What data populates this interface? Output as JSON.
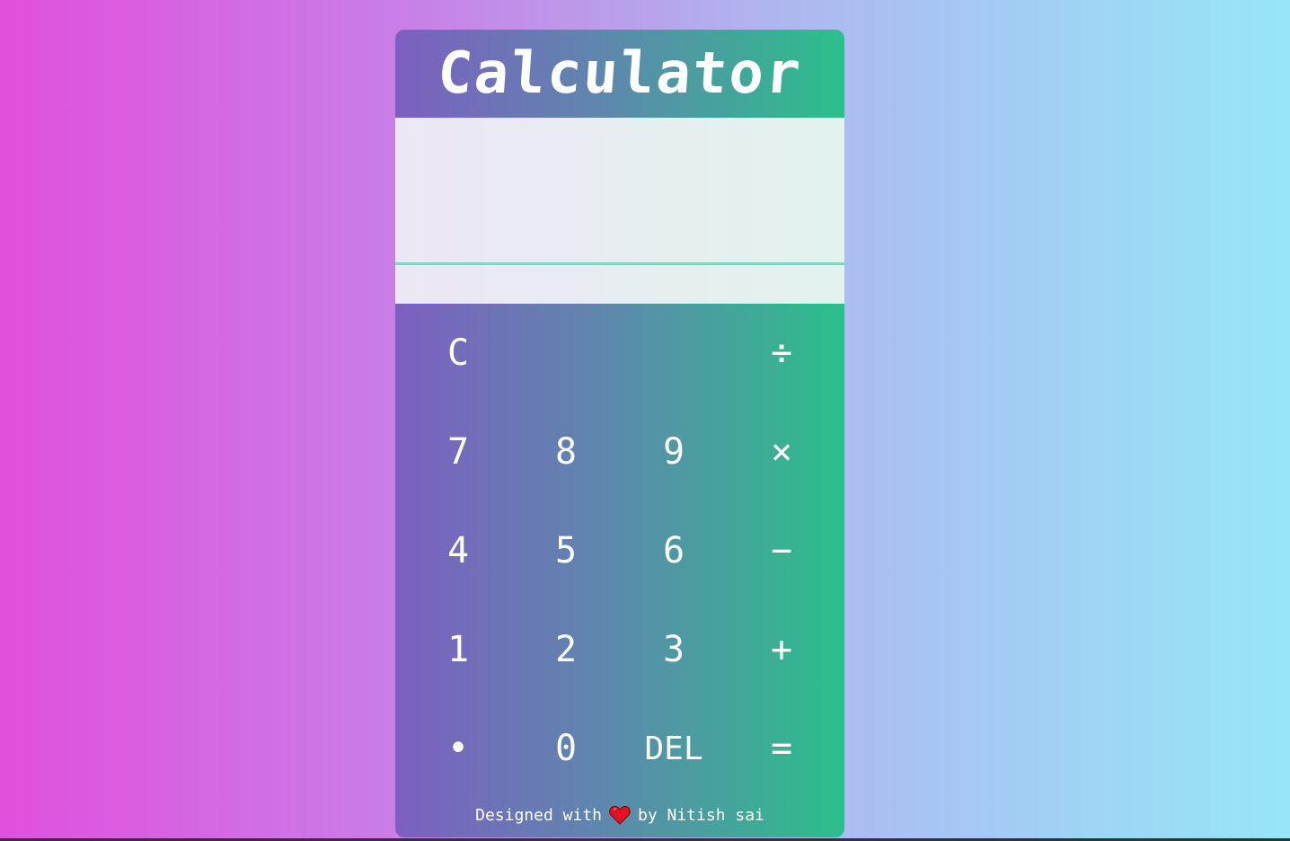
{
  "title": "Calculator",
  "display": {
    "previous": "",
    "current": ""
  },
  "keys": [
    {
      "label": "C",
      "name": "clear-button"
    },
    {
      "label": "",
      "name": "blank-key"
    },
    {
      "label": "",
      "name": "blank-key"
    },
    {
      "label": "÷",
      "name": "divide-button"
    },
    {
      "label": "7",
      "name": "digit-7-button"
    },
    {
      "label": "8",
      "name": "digit-8-button"
    },
    {
      "label": "9",
      "name": "digit-9-button"
    },
    {
      "label": "×",
      "name": "multiply-button"
    },
    {
      "label": "4",
      "name": "digit-4-button"
    },
    {
      "label": "5",
      "name": "digit-5-button"
    },
    {
      "label": "6",
      "name": "digit-6-button"
    },
    {
      "label": "−",
      "name": "subtract-button"
    },
    {
      "label": "1",
      "name": "digit-1-button"
    },
    {
      "label": "2",
      "name": "digit-2-button"
    },
    {
      "label": "3",
      "name": "digit-3-button"
    },
    {
      "label": "+",
      "name": "add-button"
    },
    {
      "label": "•",
      "name": "decimal-button"
    },
    {
      "label": "0",
      "name": "digit-0-button"
    },
    {
      "label": "DEL",
      "name": "delete-button"
    },
    {
      "label": "=",
      "name": "equals-button"
    }
  ],
  "footer": {
    "prefix": "Designed with",
    "suffix": "by Nitish sai",
    "icon": "heart-icon"
  },
  "colors": {
    "heart": "#e0141e"
  }
}
